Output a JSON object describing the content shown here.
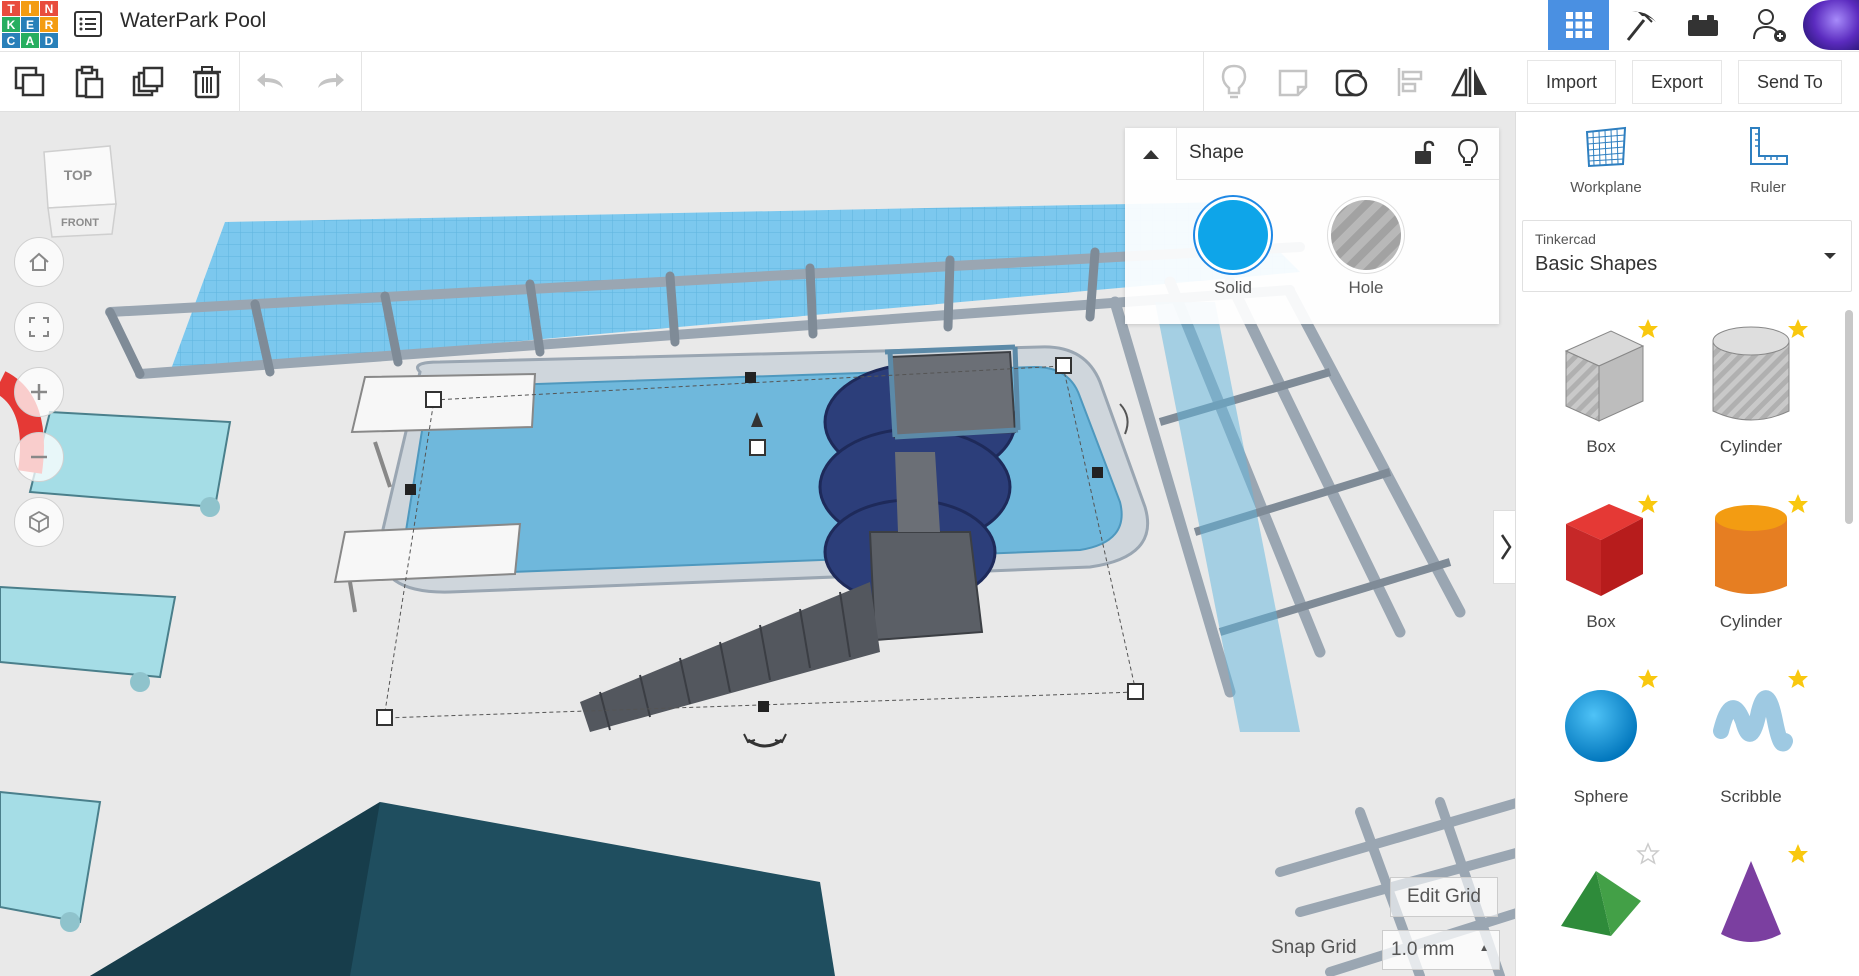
{
  "header": {
    "logo_letters": [
      "T",
      "I",
      "N",
      "K",
      "E",
      "R",
      "C",
      "A",
      "D"
    ],
    "design_title": "WaterPark Pool",
    "views": [
      "grid-view-icon",
      "tinker-pickaxe-icon",
      "bricks-icon"
    ],
    "add_user_icon": "user-plus-icon"
  },
  "toolbar": {
    "left_tools": [
      "copy-icon",
      "paste-icon",
      "duplicate-icon",
      "delete-icon"
    ],
    "history": [
      "undo-icon",
      "redo-icon"
    ],
    "right_tools": [
      "bulb-icon",
      "note-icon",
      "group-icon",
      "align-icon",
      "mirror-icon"
    ],
    "import_label": "Import",
    "export_label": "Export",
    "send_to_label": "Send To"
  },
  "viewcube": {
    "top_label": "TOP",
    "front_label": "FRONT"
  },
  "shape_panel": {
    "title": "Shape",
    "solid_label": "Solid",
    "hole_label": "Hole",
    "solid_color": "#0ea5e9"
  },
  "right_panel": {
    "workplane_label": "Workplane",
    "ruler_label": "Ruler",
    "library_category": "Tinkercad",
    "library_value": "Basic Shapes",
    "shapes": [
      {
        "label": "Box",
        "favorite": true,
        "kind": "box-hole"
      },
      {
        "label": "Cylinder",
        "favorite": true,
        "kind": "cyl-hole"
      },
      {
        "label": "Box",
        "favorite": true,
        "kind": "box-red"
      },
      {
        "label": "Cylinder",
        "favorite": true,
        "kind": "cyl-orange"
      },
      {
        "label": "Sphere",
        "favorite": true,
        "kind": "sphere"
      },
      {
        "label": "Scribble",
        "favorite": true,
        "kind": "scribble"
      },
      {
        "label": "",
        "favorite": false,
        "kind": "roof"
      },
      {
        "label": "",
        "favorite": true,
        "kind": "cone"
      }
    ]
  },
  "grid": {
    "edit_grid_label": "Edit Grid",
    "snap_grid_label": "Snap Grid",
    "snap_grid_value": "1.0 mm"
  }
}
